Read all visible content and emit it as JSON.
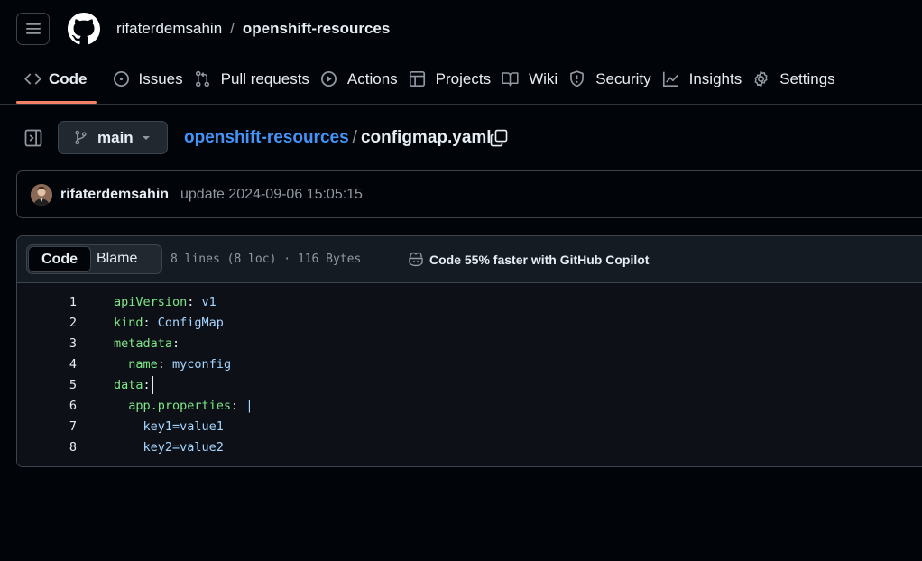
{
  "header": {
    "owner": "rifaterdemsahin",
    "separator": "/",
    "repo": "openshift-resources"
  },
  "tabs": [
    {
      "label": "Code",
      "icon": "code-icon",
      "active": true
    },
    {
      "label": "Issues",
      "icon": "issue-icon"
    },
    {
      "label": "Pull requests",
      "icon": "pull-request-icon"
    },
    {
      "label": "Actions",
      "icon": "play-icon"
    },
    {
      "label": "Projects",
      "icon": "table-icon"
    },
    {
      "label": "Wiki",
      "icon": "book-icon"
    },
    {
      "label": "Security",
      "icon": "shield-icon"
    },
    {
      "label": "Insights",
      "icon": "graph-icon"
    },
    {
      "label": "Settings",
      "icon": "gear-icon"
    }
  ],
  "file_bar": {
    "branch": "main",
    "repo_link": "openshift-resources",
    "path_sep": "/",
    "file_name": "configmap.yaml"
  },
  "commit": {
    "author": "rifaterdemsahin",
    "message": "update 2024-09-06 15:05:15"
  },
  "code_view": {
    "tab_code": "Code",
    "tab_blame": "Blame",
    "stats": "8 lines (8 loc) · 116 Bytes",
    "copilot": "Code 55% faster with GitHub Copilot",
    "lines": [
      {
        "num": "1",
        "key": "apiVersion",
        "colon": ":",
        "value": " v1"
      },
      {
        "num": "2",
        "key": "kind",
        "colon": ":",
        "value": " ConfigMap"
      },
      {
        "num": "3",
        "key": "metadata",
        "colon": ":",
        "value": ""
      },
      {
        "num": "4",
        "key": "  name",
        "colon": ":",
        "value": " myconfig"
      },
      {
        "num": "5",
        "key": "data",
        "colon": ":",
        "value": ""
      },
      {
        "num": "6",
        "key": "  app.properties",
        "colon": ":",
        "value": " |"
      },
      {
        "num": "7",
        "key": "",
        "colon": "",
        "value": "    key1=value1"
      },
      {
        "num": "8",
        "key": "",
        "colon": "",
        "value": "    key2=value2"
      }
    ]
  }
}
